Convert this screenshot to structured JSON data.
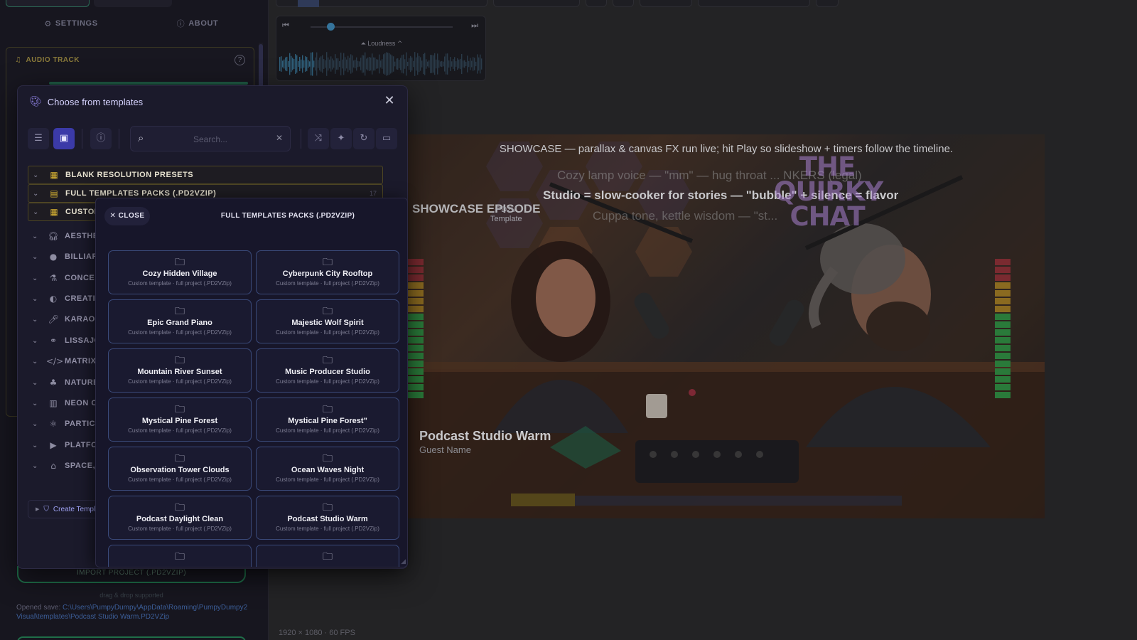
{
  "sidebar": {
    "tabs": {
      "settings": "SETTINGS",
      "about": "ABOUT"
    },
    "audio_track": {
      "label": "AUDIO TRACK",
      "help": "?"
    },
    "import_button": "IMPORT PROJECT (.PD2VZIP)",
    "drag_hint": "drag & drop supported",
    "opened_save_label": "Opened save: ",
    "opened_save_path": "C:\\Users\\PumpyDumpy\\AppData\\Roaming\\PumpyDumpy2 Visual\\templates\\Podcast Studio Warm.PD2VZip"
  },
  "player": {
    "loudness_label": "Loudness",
    "seek_position": 0.14
  },
  "preview": {
    "caption": "SHOWCASE — parallax & canvas FX run live; hit Play so slideshow + timers follow the timeline.",
    "lamp_line": "Cozy lamp voice — \"mm\" — hug throat ... NKERS (legal)",
    "studio_line": "Studio = slow-cooker for stories — \"bubble\" + silence = flavor",
    "cuppa_line": "Cuppa tone, kettle wisdom — \"st...",
    "quirky_title": "THE QUIRKY CHAT",
    "showcase_episode": "SHOWCASE EPISODE",
    "pd2v_tag": "PD2V",
    "template_tag": "Template",
    "host_title": "Podcast Studio Warm",
    "guest_name": "Guest Name",
    "meta": "1920 × 1080 · 60 FPS"
  },
  "dialog": {
    "title": "Choose from templates",
    "search_placeholder": "Search...",
    "toolbar_icons": [
      "list-toggle-icon",
      "grid-view-icon",
      "info-icon",
      "search-icon",
      "shuffle-icon",
      "magic-icon",
      "refresh-icon",
      "folder-icon"
    ],
    "categories": [
      {
        "label": "BLANK RESOLUTION PRESETS",
        "icon": "grid-icon",
        "highlight": true,
        "count": ""
      },
      {
        "label": "FULL TEMPLATES PACKS (.PD2VZIP)",
        "icon": "package-icon",
        "highlight": true,
        "count": "17"
      },
      {
        "label": "CUSTOM",
        "icon": "grid-icon",
        "highlight": true,
        "count": ""
      },
      {
        "label": "AESTHET",
        "icon": "headphones-icon",
        "highlight": false,
        "count": ""
      },
      {
        "label": "BILLIARD",
        "icon": "ball-icon",
        "highlight": false,
        "count": ""
      },
      {
        "label": "CONCEPT",
        "icon": "flask-icon",
        "highlight": false,
        "count": ""
      },
      {
        "label": "CREATIV",
        "icon": "palette-icon",
        "highlight": false,
        "count": ""
      },
      {
        "label": "KARAOK",
        "icon": "microphone-icon",
        "highlight": false,
        "count": ""
      },
      {
        "label": "LISSAJOU",
        "icon": "nodes-icon",
        "highlight": false,
        "count": ""
      },
      {
        "label": "MATRIX,",
        "icon": "code-icon",
        "highlight": false,
        "count": ""
      },
      {
        "label": "NATURE",
        "icon": "tree-icon",
        "highlight": false,
        "count": ""
      },
      {
        "label": "NEON CI",
        "icon": "building-icon",
        "highlight": false,
        "count": ""
      },
      {
        "label": "PARTICL",
        "icon": "atom-icon",
        "highlight": false,
        "count": ""
      },
      {
        "label": "PLATFOR",
        "icon": "play-box-icon",
        "highlight": false,
        "count": ""
      },
      {
        "label": "SPACE, S",
        "icon": "rocket-icon",
        "highlight": false,
        "count": ""
      }
    ],
    "create_template": "Create Templ"
  },
  "packs": {
    "close_label": "CLOSE",
    "title": "FULL TEMPLATES PACKS (.PD2VZIP)",
    "items": [
      {
        "name": "Cozy Hidden Village",
        "sub": "Custom template · full project (.PD2VZip)"
      },
      {
        "name": "Cyberpunk City Rooftop",
        "sub": "Custom template · full project (.PD2VZip)"
      },
      {
        "name": "Epic Grand Piano",
        "sub": "Custom template · full project (.PD2VZip)"
      },
      {
        "name": "Majestic Wolf Spirit",
        "sub": "Custom template · full project (.PD2VZip)"
      },
      {
        "name": "Mountain River Sunset",
        "sub": "Custom template · full project (.PD2VZip)"
      },
      {
        "name": "Music Producer Studio",
        "sub": "Custom template · full project (.PD2VZip)"
      },
      {
        "name": "Mystical Pine Forest",
        "sub": "Custom template · full project (.PD2VZip)"
      },
      {
        "name": "Mystical Pine Forest\"",
        "sub": "Custom template · full project (.PD2VZip)"
      },
      {
        "name": "Observation Tower Clouds",
        "sub": "Custom template · full project (.PD2VZip)"
      },
      {
        "name": "Ocean Waves Night",
        "sub": "Custom template · full project (.PD2VZip)"
      },
      {
        "name": "Podcast Daylight Clean",
        "sub": "Custom template · full project (.PD2VZip)"
      },
      {
        "name": "Podcast Studio Warm",
        "sub": "Custom template · full project (.PD2VZip)"
      },
      {
        "name": "",
        "sub": ""
      },
      {
        "name": "",
        "sub": ""
      }
    ]
  },
  "colors": {
    "accent": "#3b3aa8",
    "highlight_gold": "#d7b233",
    "card_border": "#3a4a7a",
    "green": "#1f6e49"
  }
}
